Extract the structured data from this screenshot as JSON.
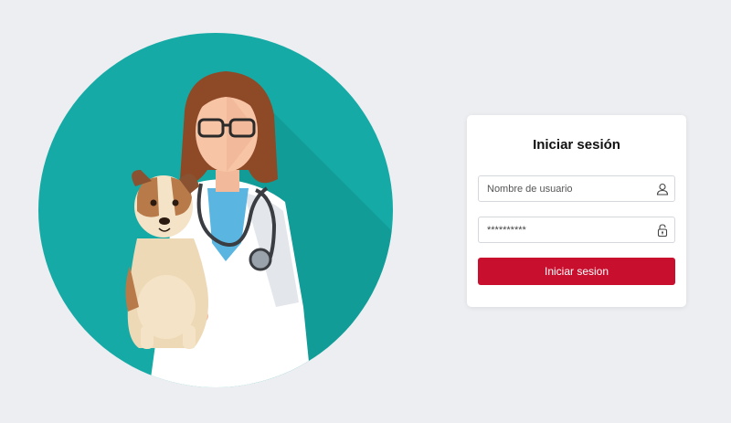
{
  "login": {
    "title": "Iniciar sesión",
    "username_placeholder": "Nombre de usuario",
    "password_value": "**********",
    "submit_label": "Iniciar sesion"
  },
  "icons": {
    "username": "user-icon",
    "password": "lock-icon"
  },
  "colors": {
    "background": "#eceef1",
    "accent": "#c8102e",
    "circle": "#16aaa6"
  }
}
